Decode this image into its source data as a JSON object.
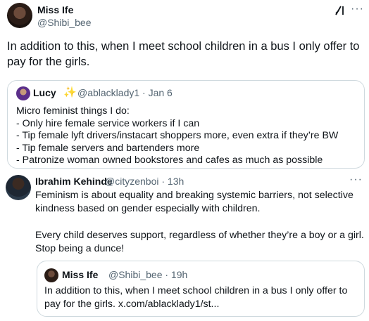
{
  "main_tweet": {
    "author_name": "Miss Ife",
    "author_handle": "@Shibi_bee",
    "text": "In addition to this, when I meet school children in a bus I only offer to pay for the girls."
  },
  "quoted_tweet": {
    "author_name": "Lucy",
    "meta": "@ablacklady1 · Jan 6",
    "lines": [
      "Micro feminist things I do:",
      "- Only hire female service workers if I can",
      "- Tip female lyft drivers/instacart shoppers more, even extra if they’re BW",
      "- Tip female servers and bartenders more",
      "- Patronize woman owned bookstores and cafes as much as possible"
    ]
  },
  "reply": {
    "author_name": "Ibrahim Kehinde",
    "meta": "@cityzenboi · 13h",
    "paragraph_1": "Feminism is about equality and breaking systemic barriers, not selective kindness based on gender especially with children.",
    "paragraph_2": "Every child deserves support, regardless of whether they’re a boy or a girl. Stop being a dunce!"
  },
  "reply_quote": {
    "author_name": "Miss Ife",
    "meta": "@Shibi_bee · 19h",
    "text": "In addition to this, when I meet school children in a bus I only offer to pay for the girls. x.com/ablacklady1/st..."
  },
  "icons": {
    "grok": "grok-icon",
    "more": "more-options-icon",
    "sparkle": "sparkle-emoji"
  },
  "colors": {
    "text": "#0f1419",
    "secondary": "#536471",
    "border": "#cfd9de",
    "sparkle": "#f4c430"
  }
}
